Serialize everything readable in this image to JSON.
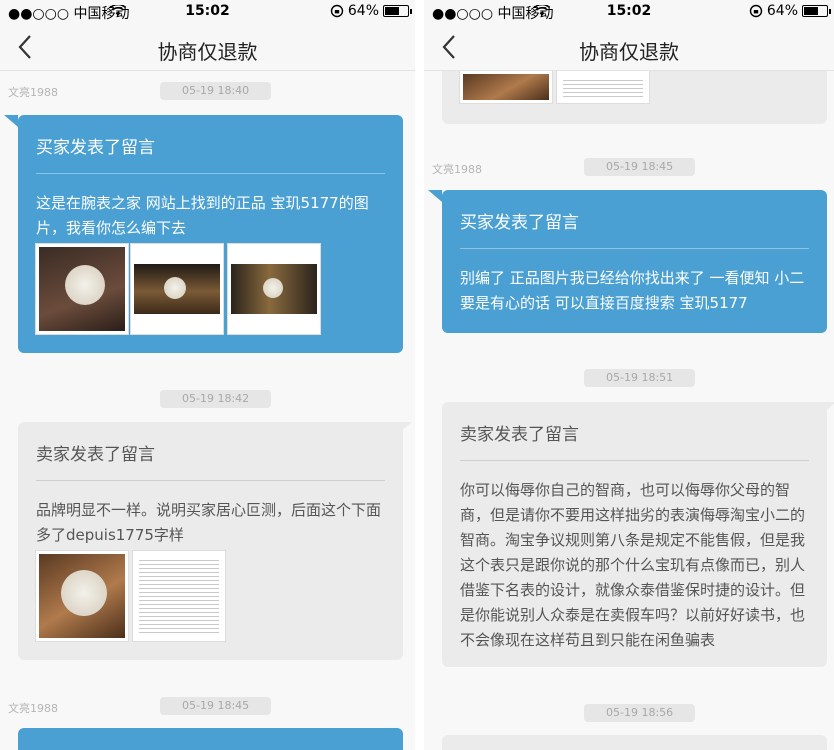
{
  "status_bar": {
    "carrier": "●●○○○ 中国移动",
    "time": "15:02",
    "battery": "64%",
    "battery_level": 0.64
  },
  "nav": {
    "title": "协商仅退款"
  },
  "left_pane": {
    "sender_1": "文亮1988",
    "time_1": "05-19 18:40",
    "msg1": {
      "header": "买家发表了留言",
      "body": "这是在腕表之家 网站上找到的正品 宝玑5177的图片，我看你怎么编下去"
    },
    "time_2": "05-19 18:42",
    "msg2": {
      "header": "卖家发表了留言",
      "body": "品牌明显不一样。说明买家居心叵测，后面这个下面多了depuis1775字样"
    },
    "sender_3": "文亮1988",
    "time_3": "05-19 18:45"
  },
  "right_pane": {
    "sender_1": "文亮1988",
    "time_1": "05-19 18:45",
    "msg1": {
      "header": "买家发表了留言",
      "body": "别编了 正品图片我已经给你找出来了 一看便知 小二要是有心的话 可以直接百度搜索 宝玑5177"
    },
    "time_2": "05-19 18:51",
    "msg2": {
      "header": "卖家发表了留言",
      "body": "你可以侮辱你自己的智商，也可以侮辱你父母的智商，但是请你不要用这样拙劣的表演侮辱淘宝小二的智商。淘宝争议规则第八条是规定不能售假，但是我这个表只是跟你说的那个什么宝玑有点像而已，别人借鉴下名表的设计，就像众泰借鉴保时捷的设计。但是你能说别人众泰是在卖假车吗？以前好好读书，也不会像现在这样苟且到只能在闲鱼骗表"
    },
    "time_3": "05-19 18:56"
  },
  "icons": [
    "back-arrow-icon",
    "wifi-icon",
    "rotation-lock-icon",
    "battery-icon"
  ]
}
